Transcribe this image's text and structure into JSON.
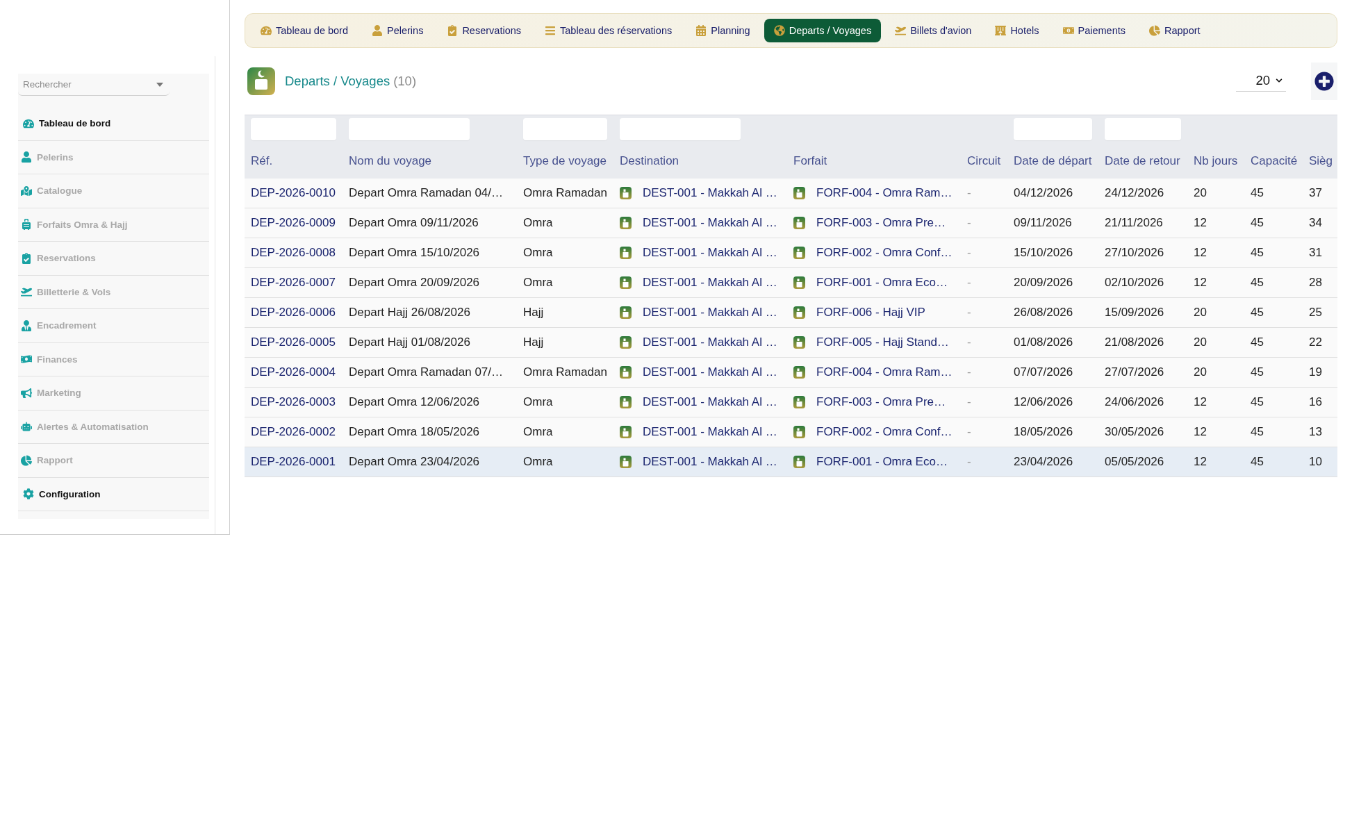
{
  "sidebar": {
    "search": {
      "placeholder": "Rechercher"
    },
    "items": [
      {
        "label": "Tableau de bord",
        "selected": true
      },
      {
        "label": "Pelerins",
        "selected": false
      },
      {
        "label": "Catalogue",
        "selected": false
      },
      {
        "label": "Forfaits Omra & Hajj",
        "selected": false
      },
      {
        "label": "Reservations",
        "selected": false
      },
      {
        "label": "Billetterie & Vols",
        "selected": false
      },
      {
        "label": "Encadrement",
        "selected": false
      },
      {
        "label": "Finances",
        "selected": false
      },
      {
        "label": "Marketing",
        "selected": false
      },
      {
        "label": "Alertes & Automatisation",
        "selected": false
      },
      {
        "label": "Rapport",
        "selected": false
      },
      {
        "label": "Configuration",
        "selected": true
      }
    ]
  },
  "nav": {
    "tabs": [
      {
        "label": "Tableau de bord",
        "selected": false
      },
      {
        "label": "Pelerins",
        "selected": false
      },
      {
        "label": "Reservations",
        "selected": false
      },
      {
        "label": "Tableau des réservations",
        "selected": false
      },
      {
        "label": "Planning",
        "selected": false
      },
      {
        "label": "Departs / Voyages",
        "selected": true
      },
      {
        "label": "Billets d'avion",
        "selected": false
      },
      {
        "label": "Hotels",
        "selected": false
      },
      {
        "label": "Paiements",
        "selected": false
      },
      {
        "label": "Rapport",
        "selected": false
      }
    ]
  },
  "page_header": {
    "title": "Departs / Voyages",
    "count": "(10)",
    "page_size": "20"
  },
  "table": {
    "columns": [
      {
        "label": "Réf.",
        "kind": "link",
        "filter": true
      },
      {
        "label": "Nom du voyage",
        "kind": "text",
        "filter": true
      },
      {
        "label": "Type de voyage",
        "kind": "text",
        "filter": true
      },
      {
        "label": "Destination",
        "kind": "record",
        "filter": true
      },
      {
        "label": "Forfait",
        "kind": "record",
        "filter": false
      },
      {
        "label": "Circuit",
        "kind": "muted",
        "filter": false
      },
      {
        "label": "Date de départ",
        "kind": "text",
        "filter": true
      },
      {
        "label": "Date de retour",
        "kind": "text",
        "filter": true
      },
      {
        "label": "Nb jours",
        "kind": "text",
        "filter": false
      },
      {
        "label": "Capacité",
        "kind": "text",
        "filter": false
      },
      {
        "label": "Sièg",
        "kind": "text",
        "filter": false
      }
    ],
    "rows": [
      {
        "selected": false,
        "cells": [
          "DEP-2026-0010",
          "Depart Omra Ramadan 04/…",
          "Omra Ramadan",
          "DEST-001 - Makkah Al …",
          "FORF-004 - Omra Ram…",
          "-",
          "04/12/2026",
          "24/12/2026",
          "20",
          "45",
          "37"
        ]
      },
      {
        "selected": false,
        "cells": [
          "DEP-2026-0009",
          "Depart Omra 09/11/2026",
          "Omra",
          "DEST-001 - Makkah Al …",
          "FORF-003 - Omra Pre…",
          "-",
          "09/11/2026",
          "21/11/2026",
          "12",
          "45",
          "34"
        ]
      },
      {
        "selected": false,
        "cells": [
          "DEP-2026-0008",
          "Depart Omra 15/10/2026",
          "Omra",
          "DEST-001 - Makkah Al …",
          "FORF-002 - Omra Conf…",
          "-",
          "15/10/2026",
          "27/10/2026",
          "12",
          "45",
          "31"
        ]
      },
      {
        "selected": false,
        "cells": [
          "DEP-2026-0007",
          "Depart Omra 20/09/2026",
          "Omra",
          "DEST-001 - Makkah Al …",
          "FORF-001 - Omra Eco…",
          "-",
          "20/09/2026",
          "02/10/2026",
          "12",
          "45",
          "28"
        ]
      },
      {
        "selected": false,
        "cells": [
          "DEP-2026-0006",
          "Depart Hajj 26/08/2026",
          "Hajj",
          "DEST-001 - Makkah Al …",
          "FORF-006 - Hajj VIP",
          "-",
          "26/08/2026",
          "15/09/2026",
          "20",
          "45",
          "25"
        ]
      },
      {
        "selected": false,
        "cells": [
          "DEP-2026-0005",
          "Depart Hajj 01/08/2026",
          "Hajj",
          "DEST-001 - Makkah Al …",
          "FORF-005 - Hajj Stand…",
          "-",
          "01/08/2026",
          "21/08/2026",
          "20",
          "45",
          "22"
        ]
      },
      {
        "selected": false,
        "cells": [
          "DEP-2026-0004",
          "Depart Omra Ramadan 07/…",
          "Omra Ramadan",
          "DEST-001 - Makkah Al …",
          "FORF-004 - Omra Ram…",
          "-",
          "07/07/2026",
          "27/07/2026",
          "20",
          "45",
          "19"
        ]
      },
      {
        "selected": false,
        "cells": [
          "DEP-2026-0003",
          "Depart Omra 12/06/2026",
          "Omra",
          "DEST-001 - Makkah Al …",
          "FORF-003 - Omra Pre…",
          "-",
          "12/06/2026",
          "24/06/2026",
          "12",
          "45",
          "16"
        ]
      },
      {
        "selected": false,
        "cells": [
          "DEP-2026-0002",
          "Depart Omra 18/05/2026",
          "Omra",
          "DEST-001 - Makkah Al …",
          "FORF-002 - Omra Conf…",
          "-",
          "18/05/2026",
          "30/05/2026",
          "12",
          "45",
          "13"
        ]
      },
      {
        "selected": true,
        "cells": [
          "DEP-2026-0001",
          "Depart Omra 23/04/2026",
          "Omra",
          "DEST-001 - Makkah Al …",
          "FORF-001 - Omra Eco…",
          "-",
          "23/04/2026",
          "05/05/2026",
          "12",
          "45",
          "10"
        ]
      }
    ]
  }
}
